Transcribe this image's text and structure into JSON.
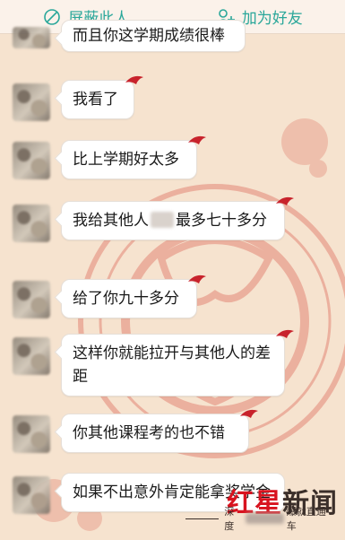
{
  "top_actions": {
    "block_label": "屏蔽此人",
    "add_friend_label": "加为好友"
  },
  "colors": {
    "accent": "#2aa79a",
    "background": "#f6e3cf",
    "papercut_red": "#e7a08f",
    "logo_red": "#d8131f"
  },
  "messages": [
    {
      "text": "而且你这学期成绩很棒"
    },
    {
      "text": "我看了"
    },
    {
      "text": "比上学期好太多"
    },
    {
      "text_before": "我给其他人",
      "text_after": "最多七十多分"
    },
    {
      "text": "给了你九十多分"
    },
    {
      "text": "这样你就能拉开与其他人的差距"
    },
    {
      "text": "你其他课程考的也不错"
    },
    {
      "text": "如果不出意外肯定能拿奖学金"
    }
  ],
  "watermark": {
    "brand_red": "红星",
    "brand_dark": "新闻",
    "tagline_start": "深度",
    "tagline_end": "爆就直通车"
  }
}
